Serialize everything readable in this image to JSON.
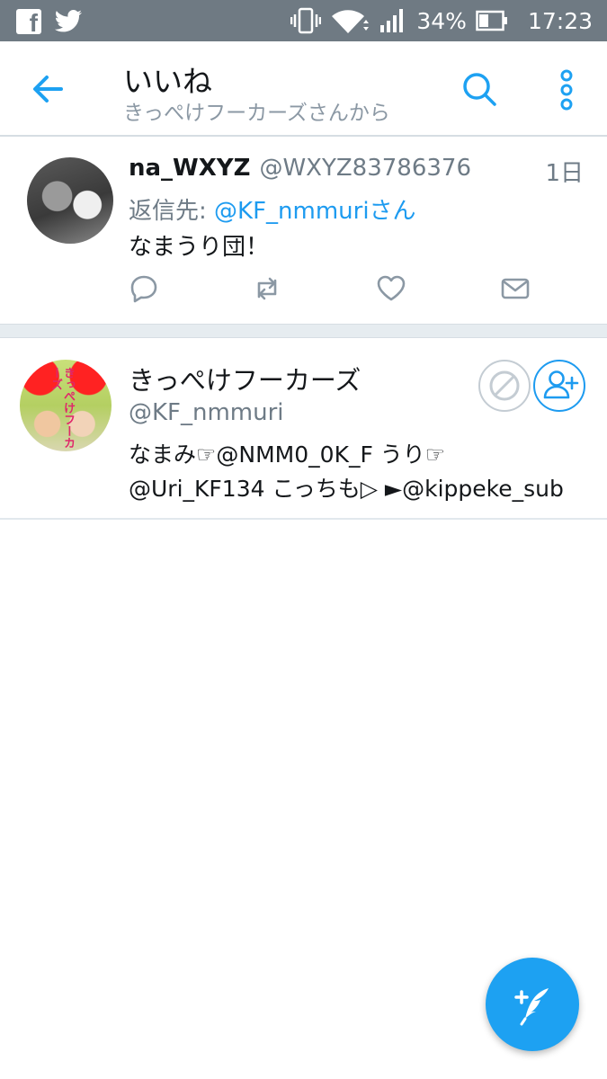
{
  "status_bar": {
    "battery": "34%",
    "time": "17:23",
    "icons": [
      "facebook-icon",
      "twitter-icon",
      "vibrate-icon",
      "wifi-icon",
      "signal-icon",
      "battery-icon"
    ]
  },
  "app_bar": {
    "title": "いいね",
    "subtitle": "きっぺけフーカーズさんから"
  },
  "tweet": {
    "name": "na_WXYZ",
    "handle": "@WXYZ83786376",
    "time": "1日",
    "reply_prefix": "返信先: ",
    "reply_to": "@KF_nmmuriさん",
    "text": "なまうり団！"
  },
  "user": {
    "name": "きっぺけフーカーズ",
    "handle": "@KF_nmmuri",
    "bio_line1": "なまみ☞@NMM0_0K_F うり☞",
    "bio_line2": "@Uri_KF134 こっちも▷ ►@kippeke_sub",
    "avatar_text": "きっぺけフーカーズ"
  },
  "colors": {
    "accent": "#1da1f2",
    "status_bar": "#6f7a83",
    "secondary_text": "#6e7b86"
  }
}
